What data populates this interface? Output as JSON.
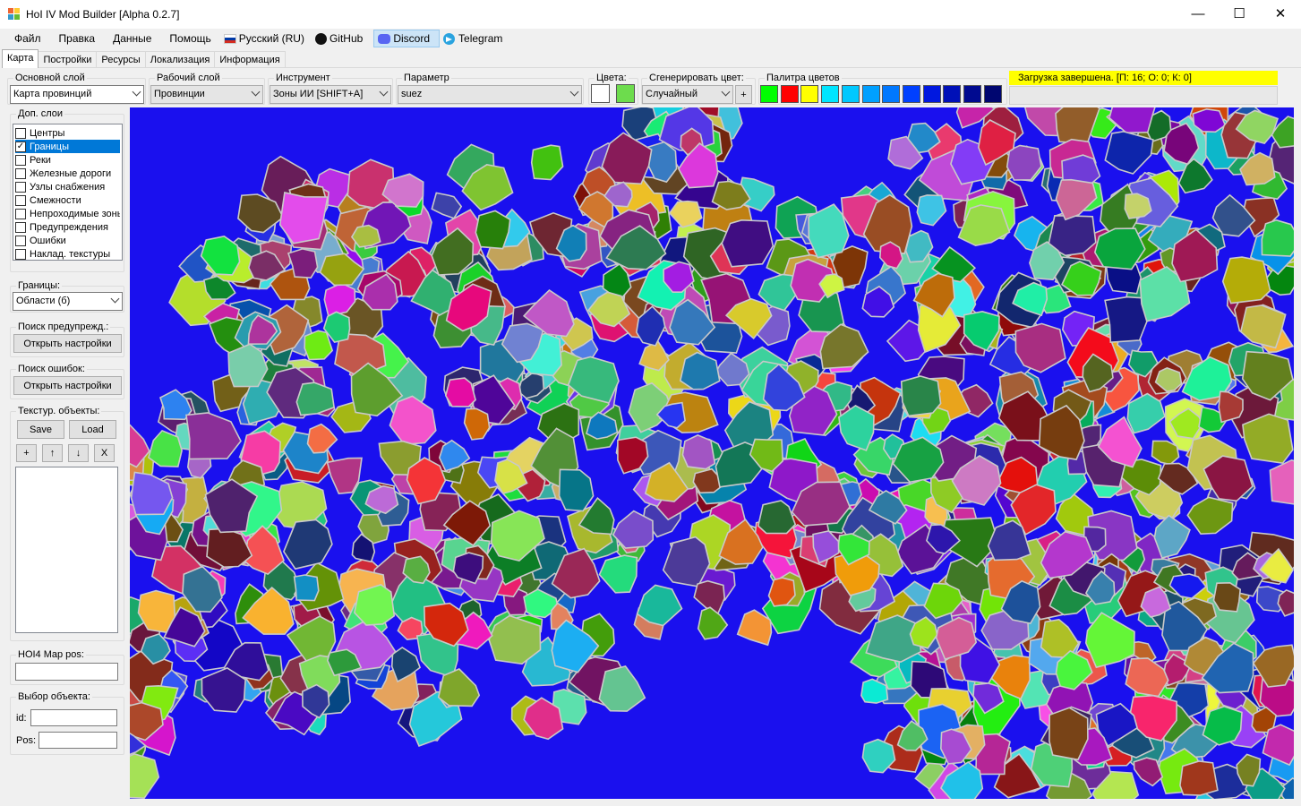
{
  "window": {
    "title": "HoI IV Mod Builder [Alpha 0.2.7]",
    "minimize": "—",
    "maximize": "☐",
    "close": "✕"
  },
  "menu": {
    "file": "Файл",
    "edit": "Правка",
    "data": "Данные",
    "help": "Помощь",
    "language": "Русский (RU)",
    "github": "GitHub",
    "discord": "Discord",
    "telegram": "Telegram"
  },
  "tabs": [
    "Карта",
    "Постройки",
    "Ресурсы",
    "Локализация",
    "Информация"
  ],
  "toolbar": {
    "main_layer": {
      "label": "Основной слой",
      "value": "Карта провинций"
    },
    "work_layer": {
      "label": "Рабочий слой",
      "value": "Провинции"
    },
    "tool": {
      "label": "Инструмент",
      "value": "Зоны ИИ [SHIFT+A]"
    },
    "parameter": {
      "label": "Параметр",
      "value": "suez"
    },
    "colors": {
      "label": "Цвета:",
      "color1": "#ffffff",
      "color2": "#6ddc4d"
    },
    "generate": {
      "label": "Сгенерировать цвет:",
      "value": "Случайный",
      "plus": "+"
    },
    "palette": {
      "label": "Палитра цветов",
      "colors": [
        "#00ff00",
        "#ff0000",
        "#ffff00",
        "#00e5ff",
        "#00c8ff",
        "#00a0ff",
        "#0078ff",
        "#0040ff",
        "#0018e0",
        "#0010b8",
        "#000a90",
        "#000670"
      ]
    },
    "status": "Загрузка завершена. [П: 16; О: 0; К: 0]"
  },
  "sidebar": {
    "layers": {
      "label": "Доп. слои",
      "items": [
        {
          "label": "Центры",
          "checked": false
        },
        {
          "label": "Границы",
          "checked": true
        },
        {
          "label": "Реки",
          "checked": false
        },
        {
          "label": "Железные дороги",
          "checked": false
        },
        {
          "label": "Узлы снабжения",
          "checked": false
        },
        {
          "label": "Смежности",
          "checked": false
        },
        {
          "label": "Непроходимые зоны",
          "checked": false
        },
        {
          "label": "Предупреждения",
          "checked": false
        },
        {
          "label": "Ошибки",
          "checked": false
        },
        {
          "label": "Наклад. текстуры",
          "checked": false
        }
      ]
    },
    "borders": {
      "label": "Границы:",
      "value": "Области (б)"
    },
    "warnings_search": {
      "label": "Поиск предупрежд.:",
      "button": "Открыть настройки"
    },
    "errors_search": {
      "label": "Поиск ошибок:",
      "button": "Открыть настройки"
    },
    "texture_objects": {
      "label": "Текстур. объекты:",
      "save": "Save",
      "load": "Load",
      "add": "+",
      "up": "↑",
      "down": "↓",
      "remove": "X"
    },
    "map_pos": {
      "label": "HOI4 Map pos:",
      "value": ""
    },
    "object_select": {
      "label": "Выбор объекта:",
      "id_label": "id:",
      "pos_label": "Pos:"
    }
  },
  "map": {
    "sea_color": "#1a10ee"
  }
}
